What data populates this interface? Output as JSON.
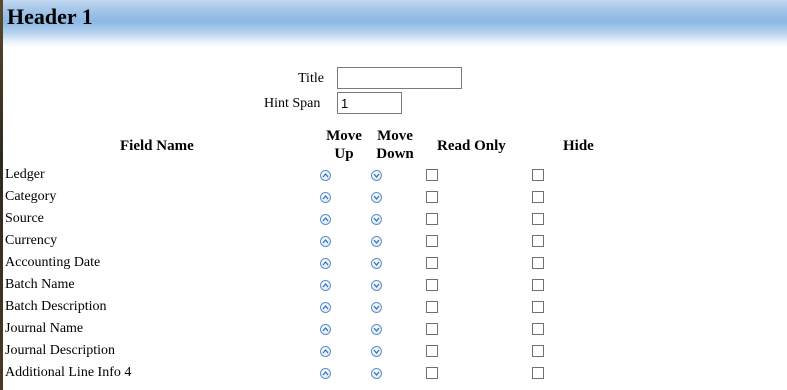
{
  "header": {
    "title": "Header 1"
  },
  "form": {
    "title_label": "Title",
    "title_value": "",
    "hint_span_label": "Hint Span",
    "hint_span_value": "1"
  },
  "columns": {
    "field_name": "Field Name",
    "move_up_line1": "Move",
    "move_up_line2": "Up",
    "move_down_line1": "Move",
    "move_down_line2": "Down",
    "read_only": "Read Only",
    "hide": "Hide"
  },
  "icons": {
    "move_up": "chevron-up-circle-icon",
    "move_down": "chevron-down-circle-icon"
  },
  "colors": {
    "header_gradient_top": "#c3d9f0",
    "header_gradient_mid": "#8cb8e4",
    "arrow_border": "#5f8fc9"
  },
  "rows": [
    {
      "label": "Ledger",
      "read_only": false,
      "hide": false
    },
    {
      "label": "Category",
      "read_only": false,
      "hide": false
    },
    {
      "label": "Source",
      "read_only": false,
      "hide": false
    },
    {
      "label": "Currency",
      "read_only": false,
      "hide": false
    },
    {
      "label": "Accounting Date",
      "read_only": false,
      "hide": false
    },
    {
      "label": "Batch Name",
      "read_only": false,
      "hide": false
    },
    {
      "label": "Batch Description",
      "read_only": false,
      "hide": false
    },
    {
      "label": "Journal Name",
      "read_only": false,
      "hide": false
    },
    {
      "label": "Journal Description",
      "read_only": false,
      "hide": false
    },
    {
      "label": "Additional Line Info 4",
      "read_only": false,
      "hide": false
    }
  ]
}
